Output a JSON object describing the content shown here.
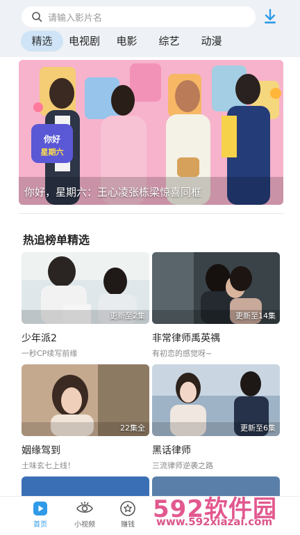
{
  "search": {
    "placeholder": "请输入影片名"
  },
  "tabs": [
    {
      "label": "精选",
      "active": true
    },
    {
      "label": "电视剧"
    },
    {
      "label": "电影"
    },
    {
      "label": "综艺"
    },
    {
      "label": "动漫"
    }
  ],
  "banner": {
    "caption": "你好，星期六：王心凌张栋梁惊喜同框"
  },
  "section": {
    "title": "热追榜单精选"
  },
  "cards": [
    {
      "title": "少年派2",
      "sub": "一秒CP续写前缘",
      "badge": "更新至2集"
    },
    {
      "title": "非常律师禹英禑",
      "sub": "有初恋的感觉呀~",
      "badge": "更新至14集"
    },
    {
      "title": "姻缘驾到",
      "sub": "土味玄七上线！",
      "badge": "22集全"
    },
    {
      "title": "黑话律师",
      "sub": "三流律师逆袭之路",
      "badge": "更新至6集"
    }
  ],
  "nav": [
    {
      "label": "首页",
      "icon": "home-play-icon",
      "active": true
    },
    {
      "label": "小视频",
      "icon": "eye-icon"
    },
    {
      "label": "赚钱",
      "icon": "star-badge-icon"
    }
  ],
  "watermark": {
    "logo": "592软件园",
    "url": "www.592xiazai.com"
  },
  "colors": {
    "accent": "#2f9ae8",
    "tab_active_bg": "#cfe5f7",
    "watermark": "#e04a86"
  }
}
